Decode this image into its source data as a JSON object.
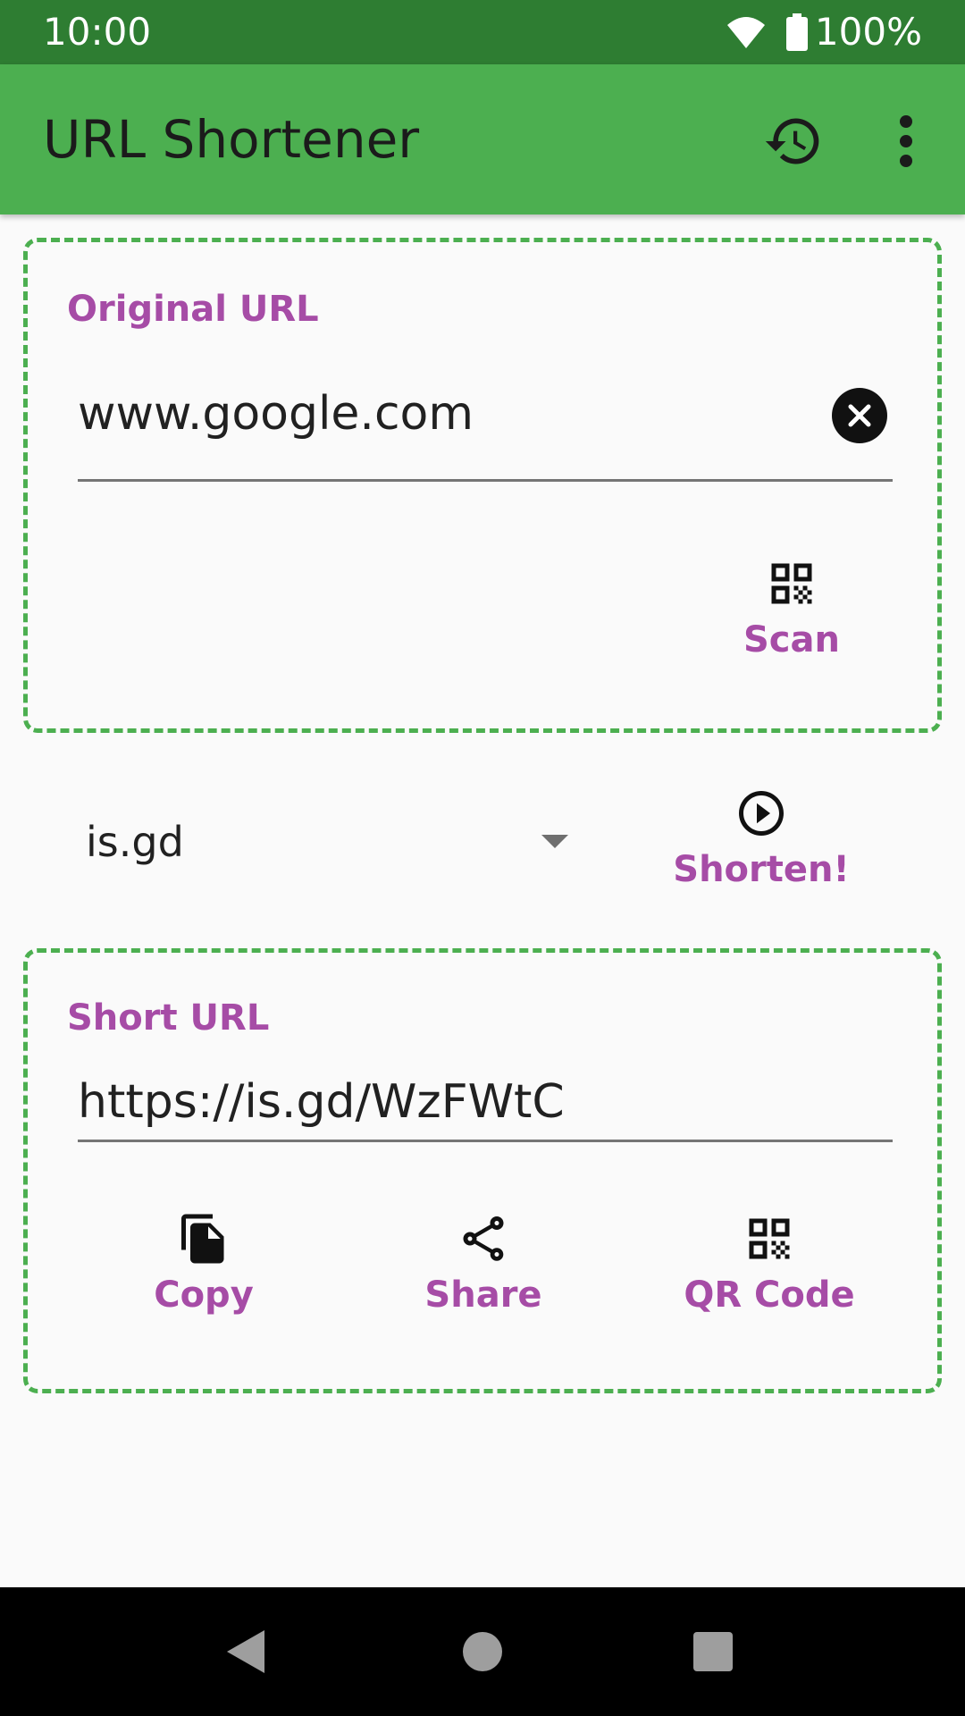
{
  "status_bar": {
    "time": "10:00",
    "battery": "100%"
  },
  "app_bar": {
    "title": "URL Shortener"
  },
  "original_url": {
    "label": "Original URL",
    "value": "www.google.com",
    "scan_label": "Scan"
  },
  "service": {
    "selected": "is.gd",
    "shorten_label": "Shorten!"
  },
  "short_url": {
    "label": "Short URL",
    "value": "https://is.gd/WzFWtC",
    "copy_label": "Copy",
    "share_label": "Share",
    "qr_label": "QR Code"
  },
  "colors": {
    "status_bar": "#2e7d32",
    "app_bar": "#4caf50",
    "accent": "#a64ca6",
    "card_border": "#4caf50"
  },
  "icons": [
    "wifi-icon",
    "battery-icon",
    "history-icon",
    "more-vert-icon",
    "clear-icon",
    "qr-code-icon",
    "play-circle-icon",
    "copy-icon",
    "share-icon",
    "back-icon",
    "home-icon",
    "recents-icon"
  ]
}
